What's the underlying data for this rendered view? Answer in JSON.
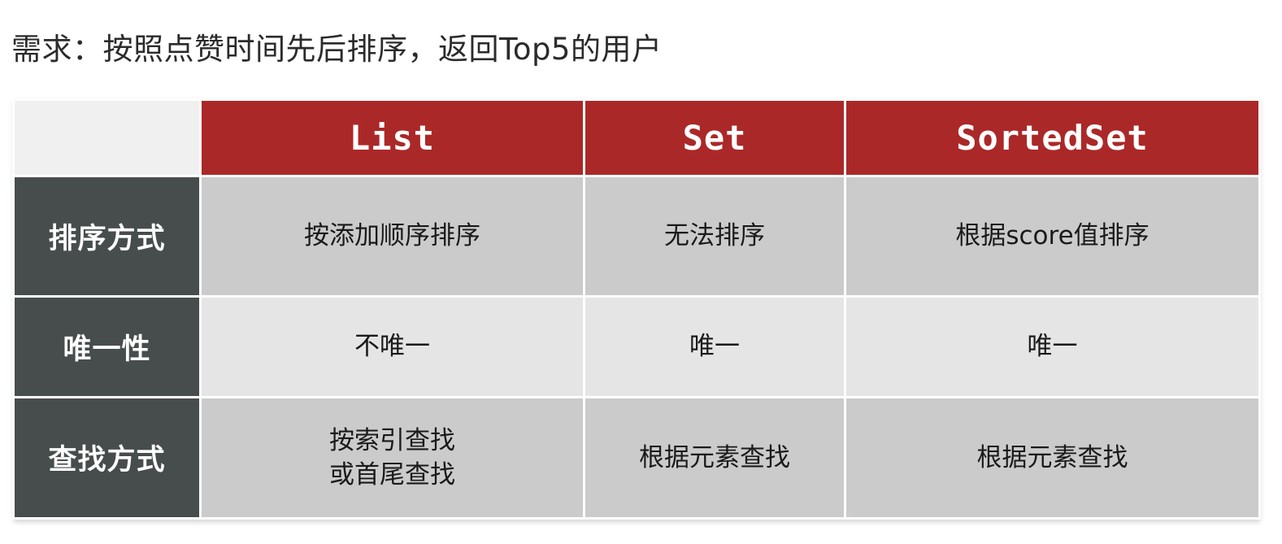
{
  "title": "需求：按照点赞时间先后排序，返回Top5的用户",
  "table": {
    "corner": "",
    "columns": [
      "List",
      "Set",
      "SortedSet"
    ],
    "rows": [
      {
        "label": "排序方式",
        "cells": [
          "按添加顺序排序",
          "无法排序",
          "根据score值排序"
        ]
      },
      {
        "label": "唯一性",
        "cells": [
          "不唯一",
          "唯一",
          "唯一"
        ]
      },
      {
        "label": "查找方式",
        "cells": [
          "按索引查找\n或首尾查找",
          "根据元素查找",
          "根据元素查找"
        ]
      }
    ]
  },
  "colors": {
    "header_red": "#ab2828",
    "row_header_dark": "#474c4c",
    "cell_dark": "#cbcbcb",
    "cell_light": "#e5e5e5"
  }
}
